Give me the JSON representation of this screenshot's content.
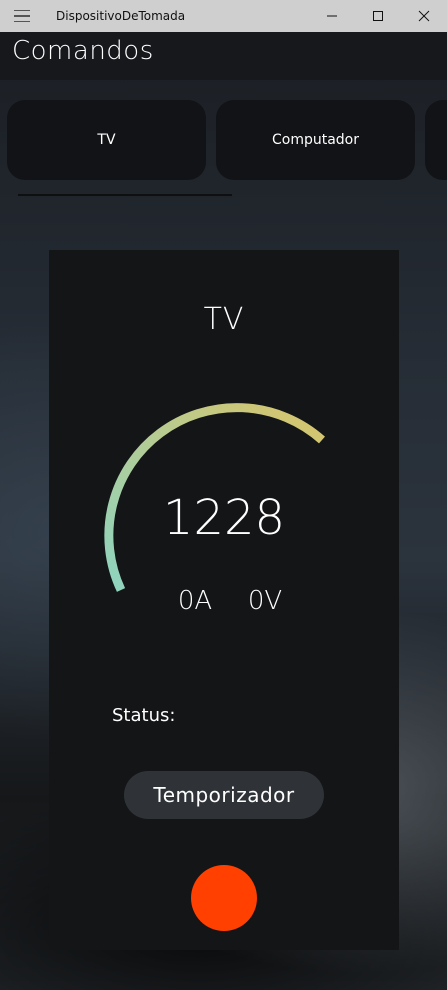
{
  "window": {
    "title": "DispositivoDeTomada",
    "icons": {
      "menu": "hamburger-icon",
      "minimize": "minimize-icon",
      "maximize": "maximize-icon",
      "close": "close-icon"
    }
  },
  "header": {
    "title": "Comandos"
  },
  "tabs": [
    {
      "label": "TV",
      "selected": true
    },
    {
      "label": "Computador",
      "selected": false
    },
    {
      "label": "",
      "selected": false
    }
  ],
  "device": {
    "name": "TV",
    "reading": "1228",
    "current": "0A",
    "voltage": "0V",
    "status_label": "Status:",
    "status_value": "",
    "timer_label": "Temporizador",
    "power_color": "#ff4000"
  },
  "colors": {
    "gauge_start": "#8ed4c0",
    "gauge_end": "#d9c46a",
    "card_bg": "#141517",
    "button_bg": "#2f3338"
  }
}
